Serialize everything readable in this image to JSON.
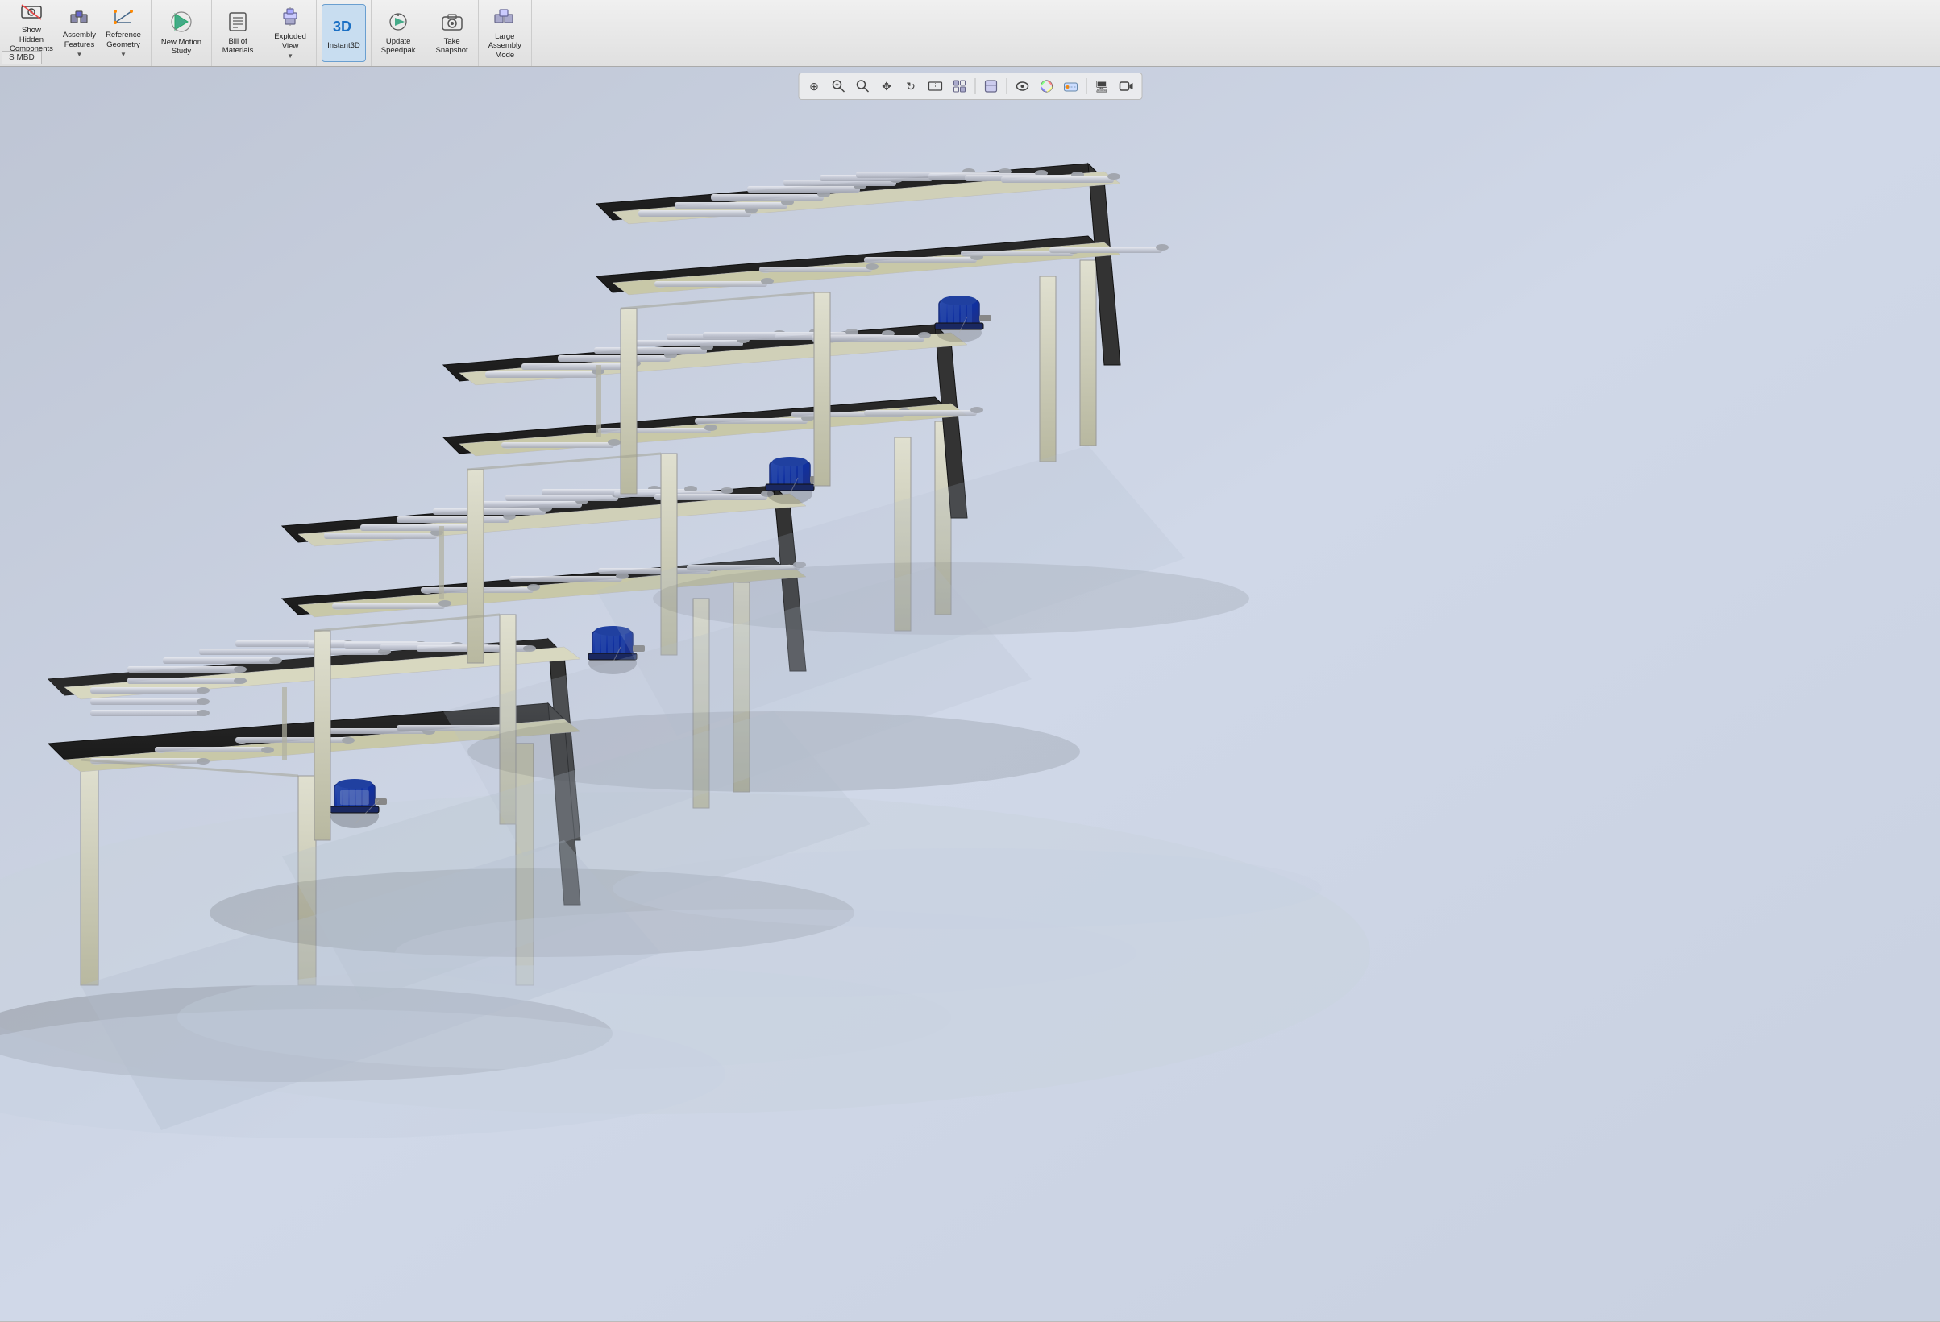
{
  "toolbar": {
    "groups": [
      {
        "id": "visibility",
        "buttons": [
          {
            "id": "show-hidden-components",
            "label": "Show\nHidden\nComponents",
            "icon": "👁",
            "has_dropdown": true
          },
          {
            "id": "assembly-features",
            "label": "Assembly\nFeatures",
            "icon": "⚙",
            "has_dropdown": true
          },
          {
            "id": "reference-geometry",
            "label": "Reference\nGeometry",
            "icon": "📐",
            "has_dropdown": true
          }
        ]
      },
      {
        "id": "motion",
        "buttons": [
          {
            "id": "new-motion-study",
            "label": "New Motion\nStudy",
            "icon": "▶",
            "has_dropdown": false
          }
        ]
      },
      {
        "id": "bom",
        "buttons": [
          {
            "id": "bill-of-materials",
            "label": "Bill of\nMaterials",
            "icon": "📋",
            "has_dropdown": false
          }
        ]
      },
      {
        "id": "exploded",
        "buttons": [
          {
            "id": "exploded-view",
            "label": "Exploded\nView",
            "icon": "💥",
            "has_dropdown": true
          }
        ]
      },
      {
        "id": "instant3d",
        "buttons": [
          {
            "id": "instant3d",
            "label": "Instant3D",
            "icon": "3D",
            "active": true,
            "has_dropdown": false
          }
        ]
      },
      {
        "id": "speedpak",
        "buttons": [
          {
            "id": "update-speedpak",
            "label": "Update\nSpeedpak",
            "icon": "⚡",
            "has_dropdown": false
          }
        ]
      },
      {
        "id": "snapshot",
        "buttons": [
          {
            "id": "take-snapshot",
            "label": "Take\nSnapshot",
            "icon": "📷",
            "has_dropdown": false
          }
        ]
      },
      {
        "id": "assembly-mode",
        "buttons": [
          {
            "id": "large-assembly-mode",
            "label": "Large\nAssembly\nMode",
            "icon": "🔧",
            "has_dropdown": false
          }
        ]
      }
    ],
    "mbd_label": "S MBD"
  },
  "floating_toolbar": {
    "icons": [
      {
        "id": "manipulator-icon",
        "symbol": "⊕",
        "tooltip": "Manipulator"
      },
      {
        "id": "zoom-icon",
        "symbol": "🔍",
        "tooltip": "Zoom"
      },
      {
        "id": "zoom-window-icon",
        "symbol": "⊞",
        "tooltip": "Zoom Window"
      },
      {
        "id": "pan-icon",
        "symbol": "✥",
        "tooltip": "Pan"
      },
      {
        "id": "rotate-icon",
        "symbol": "↻",
        "tooltip": "Rotate"
      },
      {
        "id": "section-icon",
        "symbol": "◧",
        "tooltip": "Section"
      },
      {
        "id": "view-icon",
        "symbol": "👁",
        "tooltip": "View"
      },
      {
        "id": "sep1",
        "type": "separator"
      },
      {
        "id": "display-style-icon",
        "symbol": "▣",
        "tooltip": "Display Style"
      },
      {
        "id": "sep2",
        "type": "separator"
      },
      {
        "id": "hide-show-icon",
        "symbol": "◉",
        "tooltip": "Hide/Show"
      },
      {
        "id": "appearance-icon",
        "symbol": "🎨",
        "tooltip": "Appearance"
      },
      {
        "id": "scenes-icon",
        "symbol": "🌅",
        "tooltip": "Scenes"
      },
      {
        "id": "sep3",
        "type": "separator"
      },
      {
        "id": "screen-capture-icon",
        "symbol": "🖥",
        "tooltip": "Screen Capture"
      },
      {
        "id": "record-icon",
        "symbol": "⏺",
        "tooltip": "Record"
      }
    ]
  },
  "scene": {
    "description": "3D conveyor belt assembly with roller conveyors and electric motors",
    "background_color_top": "#c8cdd8",
    "background_color_bottom": "#dde2ec"
  }
}
